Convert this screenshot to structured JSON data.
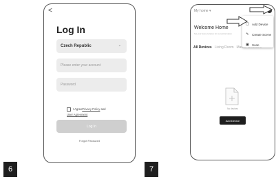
{
  "steps": [
    "6",
    "7"
  ],
  "login_screen": {
    "back_glyph": "<",
    "title": "Log In",
    "country": "Czech Republic",
    "account_placeholder": "Please enter your account",
    "password_placeholder": "Password",
    "agree_text": "I Agree",
    "privacy_link": "Privacy Policy",
    "and_text": " and",
    "user_agreement_link": "User Agreement",
    "login_button": "Log In",
    "forgot_password": "Forgot Password"
  },
  "home_screen": {
    "home_selector": "My home ▾",
    "welcome_title": "Welcome Home",
    "welcome_sub": "Set your Home location for more information",
    "tabs": [
      "All Devices",
      "Living Room",
      "Master Bedroom",
      "···"
    ],
    "no_devices": "No devices",
    "add_device_button": "Add Device",
    "menu": {
      "add_device": "Add Device",
      "create_scene": "Create Scene",
      "scan": "Scan"
    }
  }
}
